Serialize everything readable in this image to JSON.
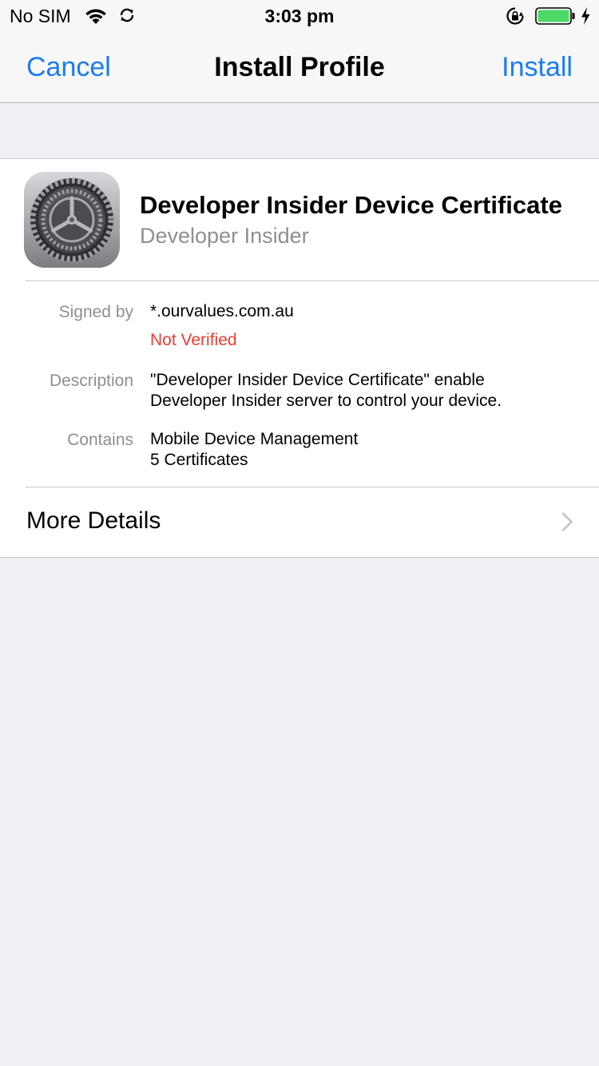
{
  "status_bar": {
    "carrier": "No SIM",
    "time": "3:03 pm",
    "wifi_icon": "wifi-icon",
    "sync_icon": "sync-icon",
    "lock_icon": "orientation-lock-icon",
    "battery_icon": "battery-icon",
    "charging_icon": "charging-bolt-icon",
    "battery_level": 1.0,
    "battery_color": "#4cd964"
  },
  "nav": {
    "cancel_label": "Cancel",
    "title": "Install Profile",
    "install_label": "Install",
    "accent_color": "#1a7cf5"
  },
  "profile": {
    "icon": "settings-gear-icon",
    "name": "Developer Insider Device Certificate",
    "organization": "Developer Insider"
  },
  "details": {
    "signed_by_label": "Signed by",
    "signed_by_value": "*.ourvalues.com.au",
    "verification_status": "Not Verified",
    "verification_color": "#f13a2f",
    "description_label": "Description",
    "description_line1": "\"Developer Insider Device Certificate\" enable",
    "description_line2": "Developer Insider server to control your device.",
    "contains_label": "Contains",
    "contains_line1": "Mobile Device Management",
    "contains_line2": "5 Certificates"
  },
  "more_details": {
    "label": "More Details",
    "chevron_icon": "chevron-right-icon"
  }
}
